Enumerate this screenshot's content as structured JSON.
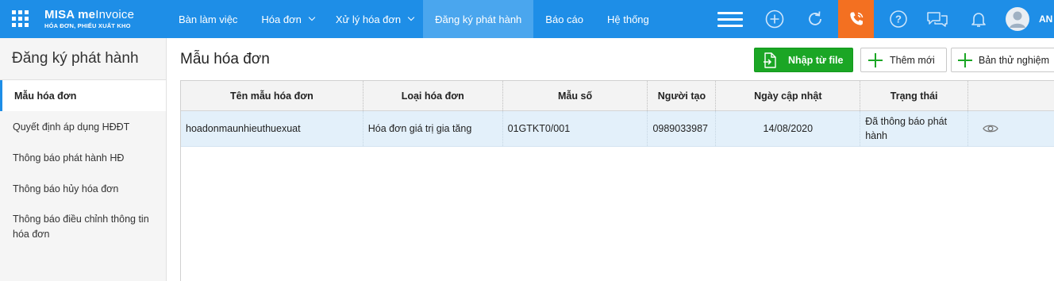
{
  "app": {
    "logo_main": "MISA meInvoice",
    "logo_main_bold": "MISA me",
    "logo_main_thin": "Invoice",
    "logo_sub": "HÓA ĐƠN, PHIẾU XUẤT KHO"
  },
  "nav": {
    "items": [
      {
        "label": "Bàn làm việc"
      },
      {
        "label": "Hóa đơn"
      },
      {
        "label": "Xử lý hóa đơn"
      },
      {
        "label": "Đăng ký phát hành"
      },
      {
        "label": "Báo cáo"
      },
      {
        "label": "Hệ thống"
      }
    ],
    "active_index": 3
  },
  "header_icons": [
    "menu-icon",
    "add-circle-icon",
    "refresh-icon",
    "phone-icon",
    "help-icon",
    "chat-icon",
    "bell-icon",
    "avatar-icon"
  ],
  "user": {
    "name": "AN"
  },
  "sidebar": {
    "title": "Đăng ký phát hành",
    "items": [
      {
        "label": "Mẫu hóa đơn",
        "active": true
      },
      {
        "label": "Quyết định áp dụng HĐĐT"
      },
      {
        "label": "Thông báo phát hành HĐ"
      },
      {
        "label": "Thông báo hủy hóa đơn"
      },
      {
        "label": "Thông báo điều chỉnh thông tin hóa đơn"
      }
    ]
  },
  "main": {
    "title": "Mẫu hóa đơn",
    "buttons": {
      "import": "Nhập từ file",
      "add": "Thêm mới",
      "draft": "Bản thử nghiệm"
    }
  },
  "table": {
    "columns": [
      "Tên mẫu hóa đơn",
      "Loại hóa đơn",
      "Mẫu số",
      "Người tạo",
      "Ngày cập nhật",
      "Trạng thái",
      ""
    ],
    "rows": [
      {
        "name": "hoadonmaunhieuthuexuat",
        "type": "Hóa đơn giá trị gia tăng",
        "code": "01GTKT0/001",
        "creator": "0989033987",
        "updated": "14/08/2020",
        "status": "Đã thông báo phát hành",
        "action_icon": "eye-icon"
      }
    ]
  },
  "colors": {
    "topbar": "#1e8ee7",
    "nav_active": "#4aa6ee",
    "phone_box": "#f37021",
    "primary_button": "#1ba625",
    "row_selected": "#e3f0fa",
    "sidebar_bg": "#f5f5f5"
  }
}
